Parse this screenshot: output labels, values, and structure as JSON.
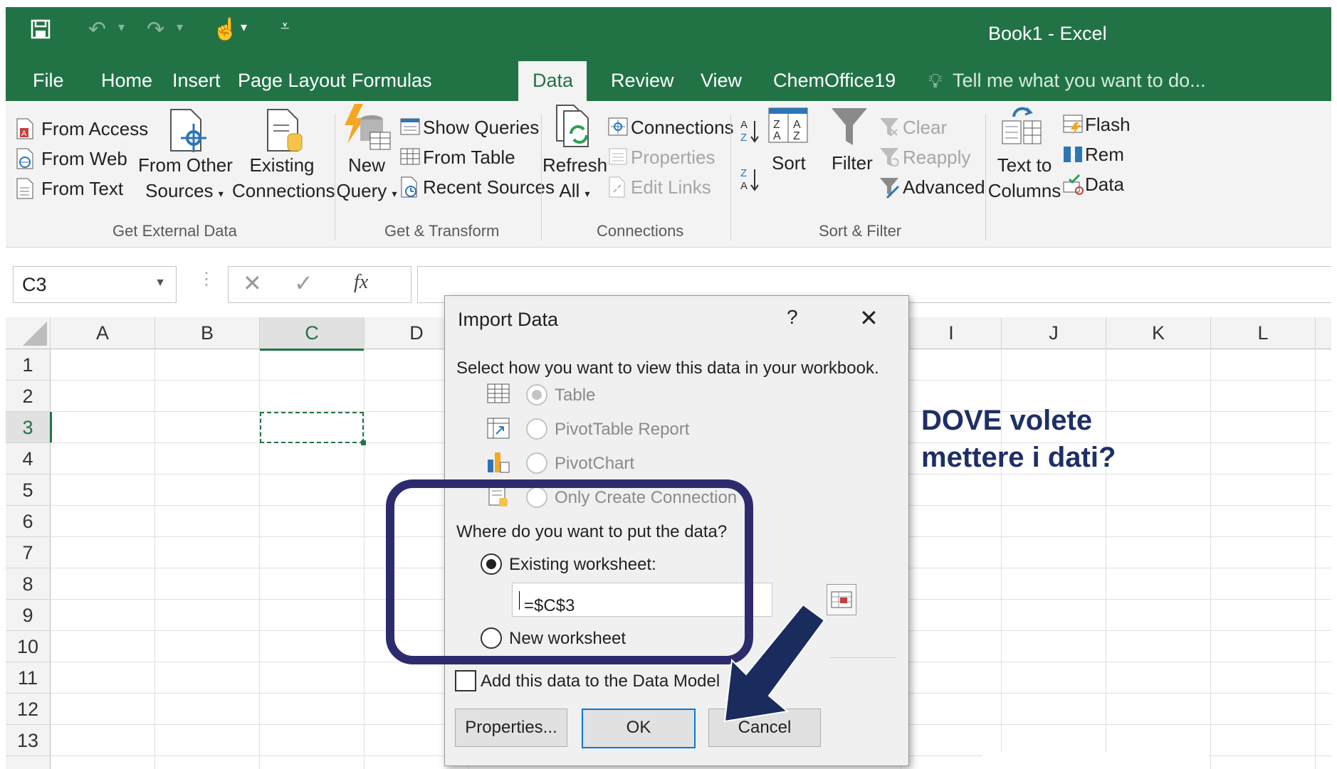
{
  "window": {
    "title": "Book1 - Excel"
  },
  "ribbon_tabs": [
    "File",
    "Home",
    "Insert",
    "Page Layout",
    "Formulas",
    "Data",
    "Review",
    "View",
    "ChemOffice19"
  ],
  "active_tab": "Data",
  "tell_me": "Tell me what you want to do...",
  "ribbon": {
    "get_external_data": {
      "from_access": "From Access",
      "from_web": "From Web",
      "from_text": "From Text",
      "from_other_1": "From Other",
      "from_other_2": "Sources",
      "existing_1": "Existing",
      "existing_2": "Connections",
      "group_label": "Get External Data"
    },
    "get_transform": {
      "new_1": "New",
      "new_2": "Query",
      "show_queries": "Show Queries",
      "from_table": "From Table",
      "recent_sources": "Recent Sources",
      "group_label": "Get & Transform"
    },
    "connections": {
      "refresh_1": "Refresh",
      "refresh_2": "All",
      "connections": "Connections",
      "properties": "Properties",
      "edit_links": "Edit Links",
      "group_label": "Connections"
    },
    "sort_filter": {
      "sort": "Sort",
      "filter": "Filter",
      "clear": "Clear",
      "reapply": "Reapply",
      "advanced": "Advanced",
      "group_label": "Sort & Filter"
    },
    "data_tools": {
      "text_to_1": "Text to",
      "text_to_2": "Columns",
      "flash": "Flash",
      "remove": "Rem",
      "data": "Data"
    }
  },
  "formula_bar": {
    "name_box": "C3",
    "fx": "fx"
  },
  "grid": {
    "columns": [
      "A",
      "B",
      "C",
      "D",
      "I",
      "J",
      "K",
      "L"
    ],
    "rows": [
      "1",
      "2",
      "3",
      "4",
      "5",
      "6",
      "7",
      "8",
      "9",
      "10",
      "11",
      "12",
      "13"
    ],
    "selected_cell": "C3"
  },
  "dialog": {
    "title": "Import Data",
    "help": "?",
    "prompt": "Select how you want to view this data in your workbook.",
    "view_options": [
      "Table",
      "PivotTable Report",
      "PivotChart",
      "Only Create Connection"
    ],
    "where_prompt": "Where do you want to put the data?",
    "existing_worksheet": "Existing worksheet:",
    "reference": "=$C$3",
    "new_worksheet": "New worksheet",
    "add_data_model": "Add this data to the Data Model",
    "buttons": {
      "properties": "Properties...",
      "ok": "OK",
      "cancel": "Cancel"
    }
  },
  "annotation": {
    "line1": "DOVE volete",
    "line2": "mettere i dati?"
  },
  "colors": {
    "excel_green": "#217346",
    "annotation_navy": "#1f2f66",
    "highlight": "#2d2b6e",
    "ok_border": "#0078d7"
  }
}
